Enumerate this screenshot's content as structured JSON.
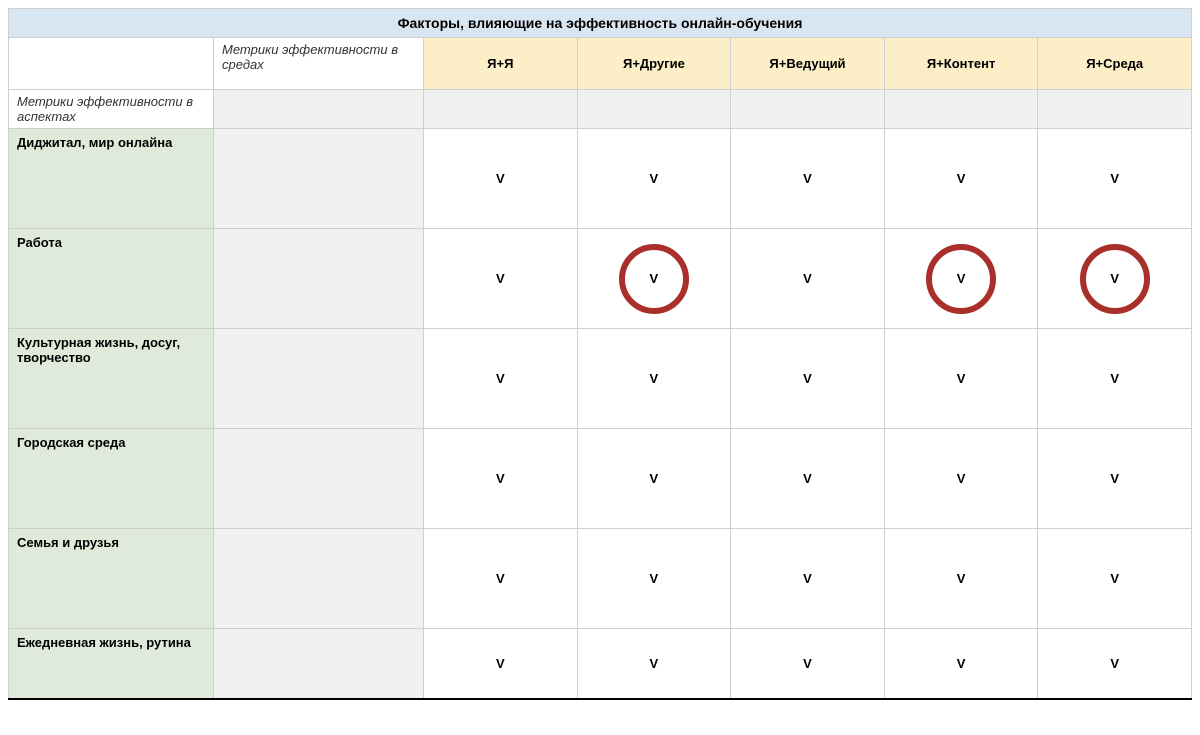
{
  "title": "Факторы, влияющие на эффективность онлайн-обучения",
  "env_header": "Метрики эффективности в средах",
  "aspect_header": "Метрики эффективности в аспектах",
  "columns": [
    "Я+Я",
    "Я+Другие",
    "Я+Ведущий",
    "Я+Контент",
    "Я+Среда"
  ],
  "mark": "V",
  "rows": [
    {
      "label": "Диджитал, мир онлайна",
      "cells": [
        {
          "value": "V",
          "circled": false
        },
        {
          "value": "V",
          "circled": false
        },
        {
          "value": "V",
          "circled": false
        },
        {
          "value": "V",
          "circled": false
        },
        {
          "value": "V",
          "circled": false
        }
      ]
    },
    {
      "label": "Работа",
      "cells": [
        {
          "value": "V",
          "circled": false
        },
        {
          "value": "V",
          "circled": true
        },
        {
          "value": "V",
          "circled": false
        },
        {
          "value": "V",
          "circled": true
        },
        {
          "value": "V",
          "circled": true
        }
      ]
    },
    {
      "label": "Культурная жизнь, досуг, творчество",
      "cells": [
        {
          "value": "V",
          "circled": false
        },
        {
          "value": "V",
          "circled": false
        },
        {
          "value": "V",
          "circled": false
        },
        {
          "value": "V",
          "circled": false
        },
        {
          "value": "V",
          "circled": false
        }
      ]
    },
    {
      "label": "Городская среда",
      "cells": [
        {
          "value": "V",
          "circled": false
        },
        {
          "value": "V",
          "circled": false
        },
        {
          "value": "V",
          "circled": false
        },
        {
          "value": "V",
          "circled": false
        },
        {
          "value": "V",
          "circled": false
        }
      ]
    },
    {
      "label": "Семья и друзья",
      "cells": [
        {
          "value": "V",
          "circled": false
        },
        {
          "value": "V",
          "circled": false
        },
        {
          "value": "V",
          "circled": false
        },
        {
          "value": "V",
          "circled": false
        },
        {
          "value": "V",
          "circled": false
        }
      ]
    },
    {
      "label": "Ежедневная жизнь, рутина",
      "cells": [
        {
          "value": "V",
          "circled": false
        },
        {
          "value": "V",
          "circled": false
        },
        {
          "value": "V",
          "circled": false
        },
        {
          "value": "V",
          "circled": false
        },
        {
          "value": "V",
          "circled": false
        }
      ]
    }
  ],
  "colors": {
    "title_bg": "#d8e6f2",
    "col_head_bg": "#fcefc7",
    "row_label_bg": "#dfeada",
    "filler_bg": "#f0f0f0",
    "circle": "#a82f2a"
  }
}
